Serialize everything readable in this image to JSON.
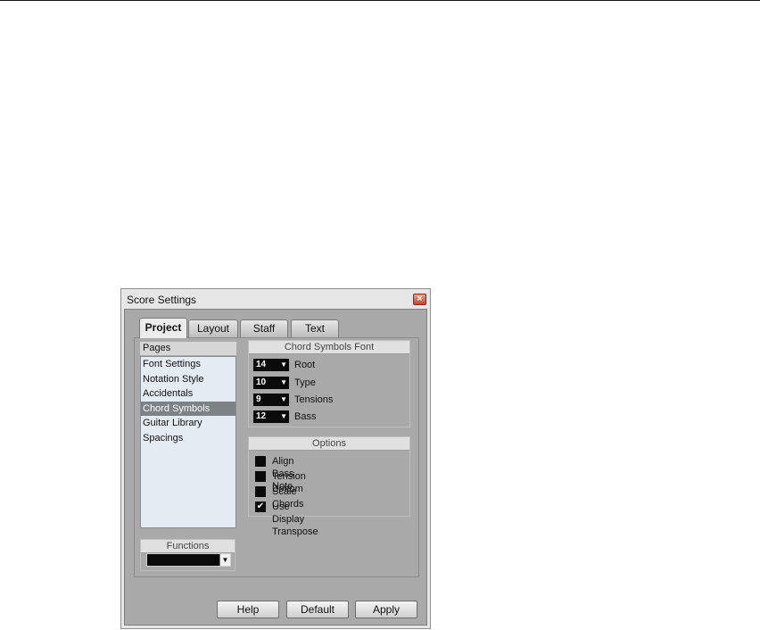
{
  "window": {
    "title": "Score Settings",
    "close_symbol": "×"
  },
  "tabs": [
    {
      "label": "Project",
      "active": true
    },
    {
      "label": "Layout",
      "active": false
    },
    {
      "label": "Staff",
      "active": false
    },
    {
      "label": "Text",
      "active": false
    }
  ],
  "pages": {
    "header": "Pages",
    "items": [
      "Font Settings",
      "Notation Style",
      "Accidentals",
      "Chord Symbols",
      "Guitar Library",
      "Spacings"
    ],
    "selected": "Chord Symbols"
  },
  "chord_font": {
    "header": "Chord Symbols Font",
    "rows": [
      {
        "value": "14",
        "label": "Root"
      },
      {
        "value": "10",
        "label": "Type"
      },
      {
        "value": "9",
        "label": "Tensions"
      },
      {
        "value": "12",
        "label": "Bass"
      }
    ]
  },
  "options": {
    "header": "Options",
    "items": [
      {
        "label": "Align Bass Note",
        "checked": false
      },
      {
        "label": "Tension Bottom",
        "checked": false
      },
      {
        "label": "Scale Chords",
        "checked": false
      },
      {
        "label": "Use Display Transpose",
        "checked": true
      }
    ]
  },
  "functions": {
    "header": "Functions",
    "value": ""
  },
  "buttons": {
    "help": "Help",
    "default": "Default",
    "apply": "Apply"
  },
  "icons": {
    "dropdown_arrow": "▼",
    "check": "✔"
  },
  "colors": {
    "selected_row": "#7d8286",
    "list_bg": "#e5ebf2",
    "panel_bg": "#a9a9a9",
    "close": "#c2452a"
  }
}
